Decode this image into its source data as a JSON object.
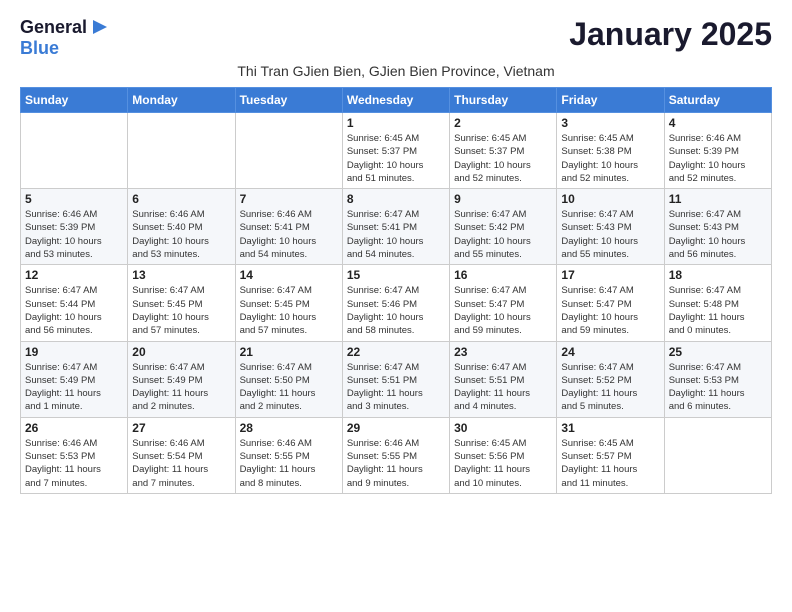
{
  "header": {
    "logo_general": "General",
    "logo_blue": "Blue",
    "month_title": "January 2025",
    "subtitle": "Thi Tran GJien Bien, GJien Bien Province, Vietnam"
  },
  "weekdays": [
    "Sunday",
    "Monday",
    "Tuesday",
    "Wednesday",
    "Thursday",
    "Friday",
    "Saturday"
  ],
  "weeks": [
    [
      {
        "day": "",
        "info": ""
      },
      {
        "day": "",
        "info": ""
      },
      {
        "day": "",
        "info": ""
      },
      {
        "day": "1",
        "info": "Sunrise: 6:45 AM\nSunset: 5:37 PM\nDaylight: 10 hours\nand 51 minutes."
      },
      {
        "day": "2",
        "info": "Sunrise: 6:45 AM\nSunset: 5:37 PM\nDaylight: 10 hours\nand 52 minutes."
      },
      {
        "day": "3",
        "info": "Sunrise: 6:45 AM\nSunset: 5:38 PM\nDaylight: 10 hours\nand 52 minutes."
      },
      {
        "day": "4",
        "info": "Sunrise: 6:46 AM\nSunset: 5:39 PM\nDaylight: 10 hours\nand 52 minutes."
      }
    ],
    [
      {
        "day": "5",
        "info": "Sunrise: 6:46 AM\nSunset: 5:39 PM\nDaylight: 10 hours\nand 53 minutes."
      },
      {
        "day": "6",
        "info": "Sunrise: 6:46 AM\nSunset: 5:40 PM\nDaylight: 10 hours\nand 53 minutes."
      },
      {
        "day": "7",
        "info": "Sunrise: 6:46 AM\nSunset: 5:41 PM\nDaylight: 10 hours\nand 54 minutes."
      },
      {
        "day": "8",
        "info": "Sunrise: 6:47 AM\nSunset: 5:41 PM\nDaylight: 10 hours\nand 54 minutes."
      },
      {
        "day": "9",
        "info": "Sunrise: 6:47 AM\nSunset: 5:42 PM\nDaylight: 10 hours\nand 55 minutes."
      },
      {
        "day": "10",
        "info": "Sunrise: 6:47 AM\nSunset: 5:43 PM\nDaylight: 10 hours\nand 55 minutes."
      },
      {
        "day": "11",
        "info": "Sunrise: 6:47 AM\nSunset: 5:43 PM\nDaylight: 10 hours\nand 56 minutes."
      }
    ],
    [
      {
        "day": "12",
        "info": "Sunrise: 6:47 AM\nSunset: 5:44 PM\nDaylight: 10 hours\nand 56 minutes."
      },
      {
        "day": "13",
        "info": "Sunrise: 6:47 AM\nSunset: 5:45 PM\nDaylight: 10 hours\nand 57 minutes."
      },
      {
        "day": "14",
        "info": "Sunrise: 6:47 AM\nSunset: 5:45 PM\nDaylight: 10 hours\nand 57 minutes."
      },
      {
        "day": "15",
        "info": "Sunrise: 6:47 AM\nSunset: 5:46 PM\nDaylight: 10 hours\nand 58 minutes."
      },
      {
        "day": "16",
        "info": "Sunrise: 6:47 AM\nSunset: 5:47 PM\nDaylight: 10 hours\nand 59 minutes."
      },
      {
        "day": "17",
        "info": "Sunrise: 6:47 AM\nSunset: 5:47 PM\nDaylight: 10 hours\nand 59 minutes."
      },
      {
        "day": "18",
        "info": "Sunrise: 6:47 AM\nSunset: 5:48 PM\nDaylight: 11 hours\nand 0 minutes."
      }
    ],
    [
      {
        "day": "19",
        "info": "Sunrise: 6:47 AM\nSunset: 5:49 PM\nDaylight: 11 hours\nand 1 minute."
      },
      {
        "day": "20",
        "info": "Sunrise: 6:47 AM\nSunset: 5:49 PM\nDaylight: 11 hours\nand 2 minutes."
      },
      {
        "day": "21",
        "info": "Sunrise: 6:47 AM\nSunset: 5:50 PM\nDaylight: 11 hours\nand 2 minutes."
      },
      {
        "day": "22",
        "info": "Sunrise: 6:47 AM\nSunset: 5:51 PM\nDaylight: 11 hours\nand 3 minutes."
      },
      {
        "day": "23",
        "info": "Sunrise: 6:47 AM\nSunset: 5:51 PM\nDaylight: 11 hours\nand 4 minutes."
      },
      {
        "day": "24",
        "info": "Sunrise: 6:47 AM\nSunset: 5:52 PM\nDaylight: 11 hours\nand 5 minutes."
      },
      {
        "day": "25",
        "info": "Sunrise: 6:47 AM\nSunset: 5:53 PM\nDaylight: 11 hours\nand 6 minutes."
      }
    ],
    [
      {
        "day": "26",
        "info": "Sunrise: 6:46 AM\nSunset: 5:53 PM\nDaylight: 11 hours\nand 7 minutes."
      },
      {
        "day": "27",
        "info": "Sunrise: 6:46 AM\nSunset: 5:54 PM\nDaylight: 11 hours\nand 7 minutes."
      },
      {
        "day": "28",
        "info": "Sunrise: 6:46 AM\nSunset: 5:55 PM\nDaylight: 11 hours\nand 8 minutes."
      },
      {
        "day": "29",
        "info": "Sunrise: 6:46 AM\nSunset: 5:55 PM\nDaylight: 11 hours\nand 9 minutes."
      },
      {
        "day": "30",
        "info": "Sunrise: 6:45 AM\nSunset: 5:56 PM\nDaylight: 11 hours\nand 10 minutes."
      },
      {
        "day": "31",
        "info": "Sunrise: 6:45 AM\nSunset: 5:57 PM\nDaylight: 11 hours\nand 11 minutes."
      },
      {
        "day": "",
        "info": ""
      }
    ]
  ]
}
